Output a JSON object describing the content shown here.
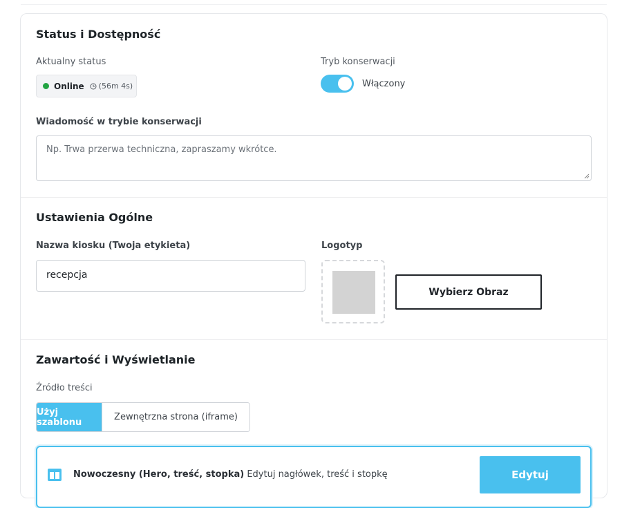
{
  "status_section": {
    "title": "Status i Dostępność",
    "current_status_label": "Aktualny status",
    "status_value": "Online",
    "uptime": "(56m 4s)",
    "maintenance_label": "Tryb konserwacji",
    "maintenance_state": "Włączony",
    "maintenance_enabled": true,
    "message_label": "Wiadomość w trybie konserwacji",
    "message_placeholder": "Np. Trwa przerwa techniczna, zapraszamy wkrótce."
  },
  "general_section": {
    "title": "Ustawienia Ogólne",
    "kiosk_name_label": "Nazwa kiosku (Twoja etykieta)",
    "kiosk_name_value": "recepcja",
    "logo_label": "Logotyp",
    "choose_image_button": "Wybierz Obraz"
  },
  "content_section": {
    "title": "Zawartość i Wyświetlanie",
    "source_label": "Źródło treści",
    "source_options": [
      "Użyj szablonu",
      "Zewnętrzna strona (iframe)"
    ],
    "source_selected": "Użyj szablonu",
    "template_name": "Nowoczesny (Hero, treść, stopka)",
    "template_description": "Edytuj nagłówek, treść i stopkę",
    "edit_button": "Edytuj"
  },
  "colors": {
    "accent": "#49c0ee",
    "online": "#22a442"
  }
}
